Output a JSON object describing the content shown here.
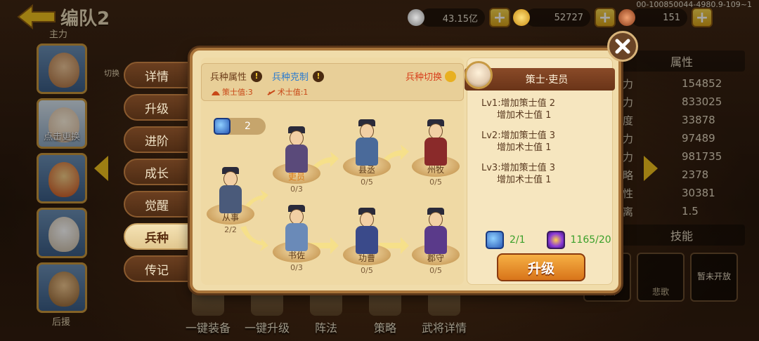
{
  "header": {
    "title": "编队2",
    "silver_amount": "43.15亿",
    "gold_amount": "52727",
    "food_amount": "151",
    "version": "00-100850044-4980.9-109~1",
    "plus": "+"
  },
  "left_column": {
    "main_label": "主力",
    "switch_label": "切换",
    "slot_text": "点击更换",
    "back_label": "后援"
  },
  "tabs": [
    "详情",
    "升级",
    "进阶",
    "成长",
    "觉醒",
    "兵种",
    "传记"
  ],
  "active_tab_index": 5,
  "bottom_bar": [
    "一键装备",
    "一键升级",
    "阵法",
    "策略",
    "武将详情"
  ],
  "stats": {
    "header": "属性",
    "rows": [
      {
        "k": "力",
        "v": "154852"
      },
      {
        "k": "力",
        "v": "833025"
      },
      {
        "k": "度",
        "v": "33878"
      },
      {
        "k": "力",
        "v": "97489"
      },
      {
        "k": "力",
        "v": "981735"
      },
      {
        "k": "略",
        "v": "2378"
      },
      {
        "k": "性",
        "v": "30381"
      },
      {
        "k": "离",
        "v": "1.5"
      }
    ],
    "skill_header": "技能",
    "skills": [
      "诗酒",
      "悲歌",
      "暂未开放"
    ]
  },
  "modal": {
    "info": {
      "attr_label": "兵种属性",
      "counter_label": "兵种克制",
      "switch_label": "兵种切换",
      "strategist_value": "策士值:3",
      "tactician_value": "术士值:1",
      "info_mark": "!"
    },
    "count": "2",
    "units": [
      {
        "name": "从事",
        "progress": "2/2"
      },
      {
        "name": "吏员",
        "progress": "0/3"
      },
      {
        "name": "书佐",
        "progress": "0/3"
      },
      {
        "name": "县丞",
        "progress": "0/5"
      },
      {
        "name": "功曹",
        "progress": "0/5"
      },
      {
        "name": "州牧",
        "progress": "0/5"
      },
      {
        "name": "郡守",
        "progress": "0/5"
      }
    ],
    "detail": {
      "title": "策士·吏员",
      "levels": [
        {
          "line1": "Lv1:增加策士值 2",
          "line2": "增加术士值 1"
        },
        {
          "line1": "Lv2:增加策士值 3",
          "line2": "增加术士值 1"
        },
        {
          "line1": "Lv3:增加策士值 3",
          "line2": "增加术士值 1"
        }
      ],
      "cost_blue": "2/1",
      "cost_purple": "1165/20",
      "upgrade_label": "升级"
    }
  }
}
